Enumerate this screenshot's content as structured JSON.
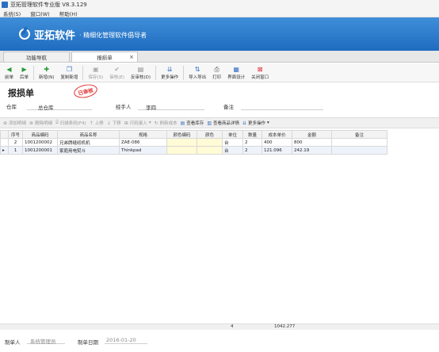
{
  "window": {
    "title": "亚拓管理软件专业版 V8.3.129"
  },
  "menu": [
    "系统(S)",
    "窗口(W)",
    "帮助(H)"
  ],
  "banner": {
    "brand": "亚拓软件",
    "slogan": "· 精细化管理软件倡导者"
  },
  "tabs": [
    {
      "label": "功能导航",
      "active": false
    },
    {
      "label": "报损单",
      "active": true,
      "close": "×"
    }
  ],
  "toolbar": [
    {
      "label": "前单",
      "icon": "arrow-left-icon",
      "enabled": true
    },
    {
      "label": "后单",
      "icon": "arrow-right-icon",
      "enabled": true
    },
    {
      "label": "新增(N)",
      "icon": "plus-icon",
      "enabled": true
    },
    {
      "label": "复制新增",
      "icon": "copy-icon",
      "enabled": true
    },
    {
      "label": "保存(S)",
      "icon": "save-icon",
      "enabled": false
    },
    {
      "label": "审核(E)",
      "icon": "check-icon",
      "enabled": false
    },
    {
      "label": "反审核(D)",
      "icon": "uncheck-icon",
      "enabled": true
    },
    {
      "label": "更多操作",
      "icon": "more-icon",
      "enabled": true,
      "dropdown": true
    },
    {
      "label": "导入导出",
      "icon": "import-export-icon",
      "enabled": true,
      "dropdown": true
    },
    {
      "label": "打印",
      "icon": "print-icon",
      "enabled": true,
      "dropdown": true
    },
    {
      "label": "界面设计",
      "icon": "layout-icon",
      "enabled": true
    },
    {
      "label": "关闭窗口",
      "icon": "close-window-icon",
      "enabled": true
    }
  ],
  "doc": {
    "title": "报损单",
    "stamp": "已审核"
  },
  "form": {
    "warehouse_label": "仓库",
    "warehouse_value": "总仓库",
    "handler_label": "经手人",
    "handler_value": "李四",
    "remark_label": "备注",
    "remark_value": ""
  },
  "gridbar": [
    {
      "label": "添加明细",
      "icon": "plus-icon",
      "enabled": false
    },
    {
      "label": "删除明细",
      "icon": "delete-icon",
      "enabled": false
    },
    {
      "label": "扫描条码(F4)",
      "icon": "barcode-icon",
      "enabled": false
    },
    {
      "label": "上移",
      "icon": "up-icon",
      "enabled": false
    },
    {
      "label": "下移",
      "icon": "down-icon",
      "enabled": false
    },
    {
      "label": "尺码录入",
      "icon": "size-icon",
      "enabled": false,
      "dropdown": true
    },
    {
      "label": "刷新成本",
      "icon": "refresh-icon",
      "enabled": false
    },
    {
      "label": "查看库存",
      "icon": "stock-icon",
      "enabled": true
    },
    {
      "label": "查看商品详情",
      "icon": "detail-icon",
      "enabled": true
    },
    {
      "label": "更多操作",
      "icon": "more-icon",
      "enabled": true,
      "dropdown": true
    }
  ],
  "columns": [
    "序号",
    "商品编码",
    "商品名称",
    "规格",
    "颜色编码",
    "颜色",
    "单位",
    "数量",
    "成本单价",
    "金额",
    "备注"
  ],
  "rows": [
    {
      "marker": "",
      "cells": [
        "2",
        "1001200002",
        "兄弟牌缝纫机机",
        "ZAE-086",
        "",
        "",
        "台",
        "2",
        "400",
        "800",
        ""
      ]
    },
    {
      "marker": "▸",
      "cells": [
        "1",
        "1001200001",
        "家庭用电熨斗",
        "Thinkpad",
        "",
        "",
        "台",
        "2",
        "121.096",
        "242.19",
        ""
      ]
    }
  ],
  "summary": {
    "qty": "4",
    "amount": "1042.277"
  },
  "footer": {
    "maker_label": "制单人",
    "maker_value": "系统管理员",
    "date_label": "制单日期",
    "date_value": "2016-01-20"
  }
}
